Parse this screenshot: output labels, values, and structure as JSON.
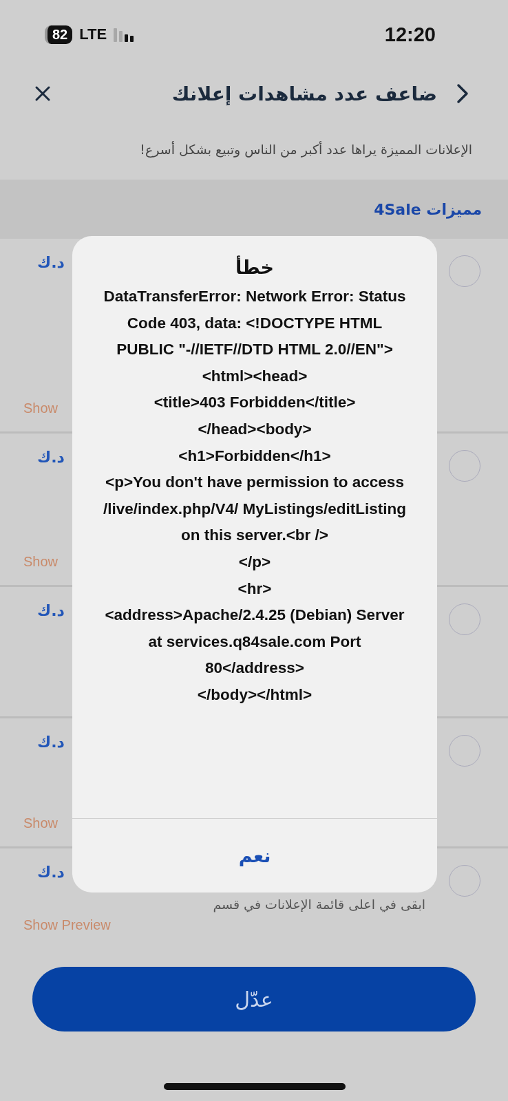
{
  "status_bar": {
    "battery": "82",
    "network": "LTE",
    "time": "12:20"
  },
  "header": {
    "title": "ضاعف عدد مشاهدات إعلانك"
  },
  "subtitle": "الإعلانات المميزة يراها عدد أكبر من الناس وتبيع بشكل أسرع!",
  "section": {
    "title": "مميزات 4Sale"
  },
  "options": [
    {
      "price": "د.ك",
      "preview": "Show",
      "selected": false
    },
    {
      "price": "د.ك",
      "preview": "Show",
      "selected": false
    },
    {
      "price": "د.ك",
      "selected": false
    },
    {
      "price": "د.ك",
      "preview": "Show",
      "selected": false
    },
    {
      "price": "د.ك",
      "preview": "Show Preview",
      "description": "ابقى في اعلى قائمة الإعلانات في قسم",
      "selected": false
    }
  ],
  "primary_button": "عدّل",
  "dialog": {
    "title": "خطأ",
    "message": "DataTransferError: Network Error: Status Code 403, data: <!DOCTYPE HTML PUBLIC \"-//IETF//DTD HTML 2.0//EN\">\n<html><head>\n<title>403 Forbidden</title>\n</head><body>\n<h1>Forbidden</h1>\n<p>You don't have permission to access /live/index.php/V4/ MyListings/editListing\non this server.<br />\n</p>\n<hr>\n<address>Apache/2.4.25 (Debian) Server at services.q84sale.com Port 80</address>\n</body></html>",
    "button": "نعم"
  }
}
